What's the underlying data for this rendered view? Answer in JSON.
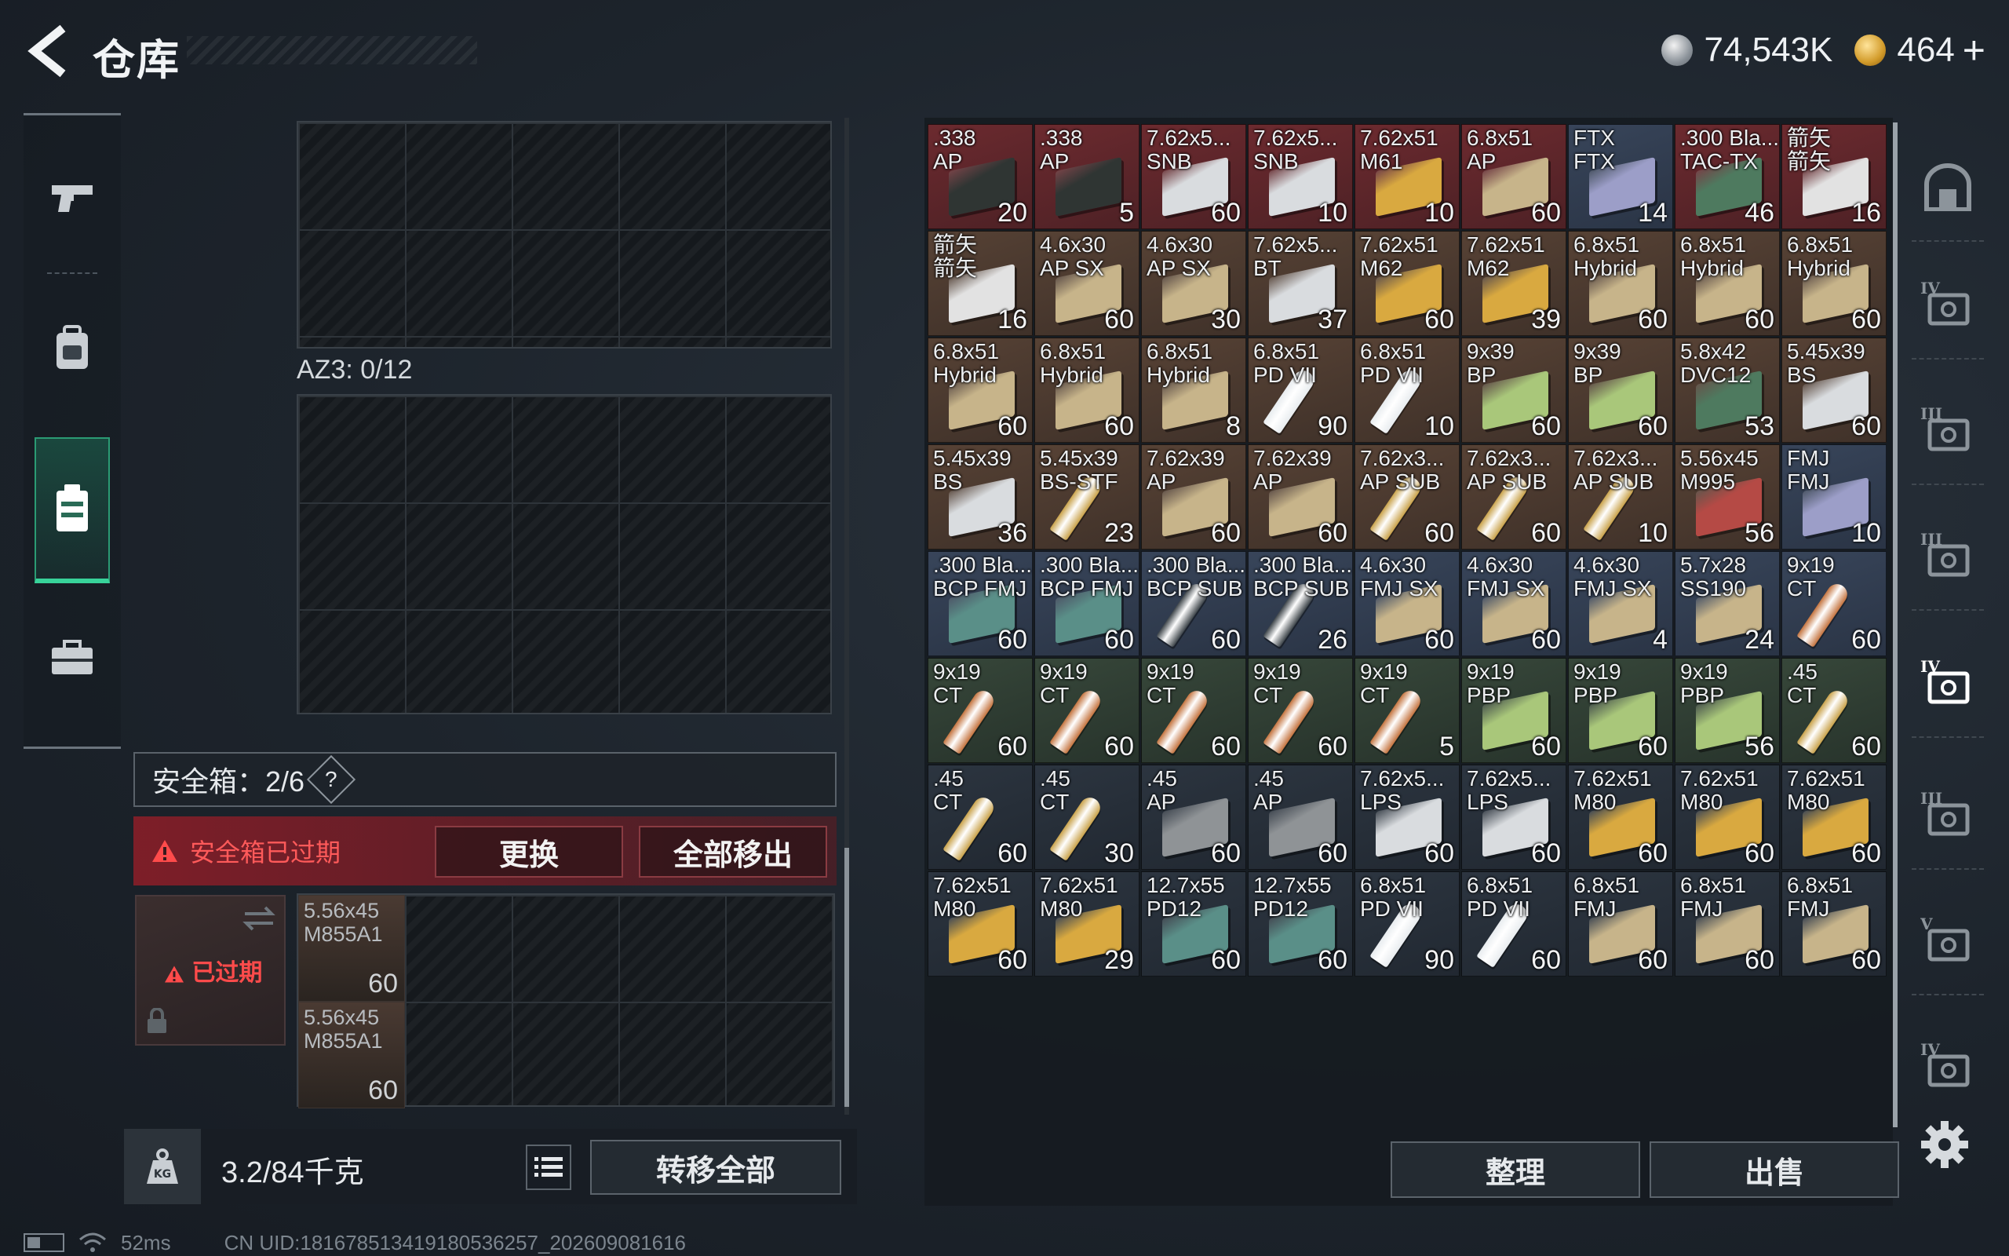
{
  "header": {
    "title": "仓库",
    "silver": "74,543K",
    "gold": "464",
    "plus": "+"
  },
  "stash": {
    "az3_label": "AZ3: 0/12",
    "safe_box_label": "安全箱：2/6",
    "help": "?",
    "expired_warning": "安全箱已过期",
    "replace_button": "更换",
    "remove_all_button": "全部移出",
    "expired_badge": "已过期",
    "safe_items": [
      {
        "name": "5.56x45\nM855A1",
        "count": "60"
      },
      {
        "name": "5.56x45\nM855A1",
        "count": "60"
      }
    ]
  },
  "bottom_left": {
    "weight": "3.2/84千克",
    "transfer_all": "转移全部"
  },
  "bottom_right": {
    "sort": "整理",
    "sell": "出售"
  },
  "status": {
    "ping": "52ms",
    "uid": "CN UID:1816785134191805362​57_202609081616"
  },
  "items": [
    {
      "name": ".338\nAP",
      "count": "20",
      "bg": "red",
      "icon": "ammo-crate-dark"
    },
    {
      "name": ".338\nAP",
      "count": "5",
      "bg": "red",
      "icon": "ammo-crate-dark"
    },
    {
      "name": "7.62x5...\nSNB",
      "count": "60",
      "bg": "red",
      "icon": "ammo-box-white"
    },
    {
      "name": "7.62x5...\nSNB",
      "count": "10",
      "bg": "red",
      "icon": "ammo-box-white"
    },
    {
      "name": "7.62x51\nM61",
      "count": "10",
      "bg": "red",
      "icon": "ammo-box-yellow"
    },
    {
      "name": "6.8x51\nAP",
      "count": "60",
      "bg": "red",
      "icon": "ammo-box-tan"
    },
    {
      "name": "FTX\nFTX",
      "count": "14",
      "bg": "blue",
      "icon": "ammo-box-violet"
    },
    {
      "name": ".300 Bla...\nTAC-TX",
      "count": "46",
      "bg": "red",
      "icon": "ammo-box-green"
    },
    {
      "name": "箭矢\n箭矢",
      "count": "16",
      "bg": "red",
      "icon": "arrow-case"
    },
    {
      "name": "箭矢\n箭矢",
      "count": "16",
      "bg": "brown",
      "icon": "arrow-case"
    },
    {
      "name": "4.6x30\nAP SX",
      "count": "60",
      "bg": "brown",
      "icon": "ammo-box-tan"
    },
    {
      "name": "4.6x30\nAP SX",
      "count": "30",
      "bg": "brown",
      "icon": "ammo-box-tan"
    },
    {
      "name": "7.62x5...\nBT",
      "count": "37",
      "bg": "brown",
      "icon": "ammo-box-white"
    },
    {
      "name": "7.62x51\nM62",
      "count": "60",
      "bg": "brown",
      "icon": "ammo-box-yellow"
    },
    {
      "name": "7.62x51\nM62",
      "count": "39",
      "bg": "brown",
      "icon": "ammo-box-yellow"
    },
    {
      "name": "6.8x51\nHybrid",
      "count": "60",
      "bg": "brown",
      "icon": "ammo-box-tan"
    },
    {
      "name": "6.8x51\nHybrid",
      "count": "60",
      "bg": "brown",
      "icon": "ammo-box-tan"
    },
    {
      "name": "6.8x51\nHybrid",
      "count": "60",
      "bg": "brown",
      "icon": "ammo-box-tan"
    },
    {
      "name": "6.8x51\nHybrid",
      "count": "60",
      "bg": "brown",
      "icon": "ammo-box-tan"
    },
    {
      "name": "6.8x51\nHybrid",
      "count": "60",
      "bg": "brown",
      "icon": "ammo-box-tan"
    },
    {
      "name": "6.8x51\nHybrid",
      "count": "8",
      "bg": "brown",
      "icon": "ammo-box-tan"
    },
    {
      "name": "6.8x51\nPD VII",
      "count": "90",
      "bg": "brown",
      "icon": "bullet-silver"
    },
    {
      "name": "6.8x51\nPD VII",
      "count": "10",
      "bg": "brown",
      "icon": "bullet-silver"
    },
    {
      "name": "9x39\nBP",
      "count": "60",
      "bg": "brown",
      "icon": "ammo-box-lime"
    },
    {
      "name": "9x39\nBP",
      "count": "60",
      "bg": "brown",
      "icon": "ammo-box-lime"
    },
    {
      "name": "5.8x42\nDVC12",
      "count": "53",
      "bg": "brown",
      "icon": "ammo-box-green"
    },
    {
      "name": "5.45x39\nBS",
      "count": "60",
      "bg": "brown",
      "icon": "ammo-box-white"
    },
    {
      "name": "5.45x39\nBS",
      "count": "36",
      "bg": "brown",
      "icon": "ammo-box-white"
    },
    {
      "name": "5.45x39\nBS-STF",
      "count": "23",
      "bg": "brown",
      "icon": "bullet-gold"
    },
    {
      "name": "7.62x39\nAP",
      "count": "60",
      "bg": "brown",
      "icon": "ammo-box-tan"
    },
    {
      "name": "7.62x39\nAP",
      "count": "60",
      "bg": "brown",
      "icon": "ammo-box-tan"
    },
    {
      "name": "7.62x3...\nAP SUB",
      "count": "60",
      "bg": "brown",
      "icon": "bullet-gold"
    },
    {
      "name": "7.62x3...\nAP SUB",
      "count": "60",
      "bg": "brown",
      "icon": "bullet-gold"
    },
    {
      "name": "7.62x3...\nAP SUB",
      "count": "10",
      "bg": "brown",
      "icon": "bullet-gold"
    },
    {
      "name": "5.56x45\nM995",
      "count": "56",
      "bg": "brown",
      "icon": "ammo-box-red"
    },
    {
      "name": "FMJ\nFMJ",
      "count": "10",
      "bg": "blue",
      "icon": "ammo-box-violet"
    },
    {
      "name": ".300 Bla...\nBCP FMJ",
      "count": "60",
      "bg": "blue",
      "icon": "ammo-box-teal"
    },
    {
      "name": ".300 Bla...\nBCP FMJ",
      "count": "60",
      "bg": "blue",
      "icon": "ammo-box-teal"
    },
    {
      "name": ".300 Bla...\nBCP SUB",
      "count": "60",
      "bg": "blue",
      "icon": "bullet-dark"
    },
    {
      "name": ".300 Bla...\nBCP SUB",
      "count": "26",
      "bg": "blue",
      "icon": "bullet-dark"
    },
    {
      "name": "4.6x30\nFMJ SX",
      "count": "60",
      "bg": "blue",
      "icon": "ammo-box-tan"
    },
    {
      "name": "4.6x30\nFMJ SX",
      "count": "60",
      "bg": "blue",
      "icon": "ammo-box-tan"
    },
    {
      "name": "4.6x30\nFMJ SX",
      "count": "4",
      "bg": "blue",
      "icon": "ammo-box-tan"
    },
    {
      "name": "5.7x28\nSS190",
      "count": "24",
      "bg": "blue",
      "icon": "ammo-box-tan"
    },
    {
      "name": "9x19\nCT",
      "count": "60",
      "bg": "blue",
      "icon": "bullet-copper"
    },
    {
      "name": "9x19\nCT",
      "count": "60",
      "bg": "green",
      "icon": "bullet-copper"
    },
    {
      "name": "9x19\nCT",
      "count": "60",
      "bg": "green",
      "icon": "bullet-copper"
    },
    {
      "name": "9x19\nCT",
      "count": "60",
      "bg": "green",
      "icon": "bullet-copper"
    },
    {
      "name": "9x19\nCT",
      "count": "60",
      "bg": "green",
      "icon": "bullet-copper"
    },
    {
      "name": "9x19\nCT",
      "count": "5",
      "bg": "green",
      "icon": "bullet-copper"
    },
    {
      "name": "9x19\nPBP",
      "count": "60",
      "bg": "green",
      "icon": "ammo-box-lime"
    },
    {
      "name": "9x19\nPBP",
      "count": "60",
      "bg": "green",
      "icon": "ammo-box-lime"
    },
    {
      "name": "9x19\nPBP",
      "count": "56",
      "bg": "green",
      "icon": "ammo-box-lime"
    },
    {
      "name": ".45\nCT",
      "count": "60",
      "bg": "green",
      "icon": "bullet-gold"
    },
    {
      "name": ".45\nCT",
      "count": "60",
      "bg": "dark",
      "icon": "bullet-gold"
    },
    {
      "name": ".45\nCT",
      "count": "30",
      "bg": "dark",
      "icon": "bullet-gold"
    },
    {
      "name": ".45\nAP",
      "count": "60",
      "bg": "dark",
      "icon": "ammo-box-grey"
    },
    {
      "name": ".45\nAP",
      "count": "60",
      "bg": "dark",
      "icon": "ammo-box-grey"
    },
    {
      "name": "7.62x5...\nLPS",
      "count": "60",
      "bg": "dark",
      "icon": "ammo-box-white"
    },
    {
      "name": "7.62x5...\nLPS",
      "count": "60",
      "bg": "dark",
      "icon": "ammo-box-white"
    },
    {
      "name": "7.62x51\nM80",
      "count": "60",
      "bg": "dark",
      "icon": "ammo-box-yellow"
    },
    {
      "name": "7.62x51\nM80",
      "count": "60",
      "bg": "dark",
      "icon": "ammo-box-yellow"
    },
    {
      "name": "7.62x51\nM80",
      "count": "60",
      "bg": "dark",
      "icon": "ammo-box-yellow"
    },
    {
      "name": "7.62x51\nM80",
      "count": "60",
      "bg": "dark",
      "icon": "ammo-box-yellow"
    },
    {
      "name": "7.62x51\nM80",
      "count": "29",
      "bg": "dark",
      "icon": "ammo-box-yellow"
    },
    {
      "name": "12.7x55\nPD12",
      "count": "60",
      "bg": "dark",
      "icon": "ammo-box-teal"
    },
    {
      "name": "12.7x55\nPD12",
      "count": "60",
      "bg": "dark",
      "icon": "ammo-box-teal"
    },
    {
      "name": "6.8x51\nPD VII",
      "count": "90",
      "bg": "dark",
      "icon": "bullet-silver"
    },
    {
      "name": "6.8x51\nPD VII",
      "count": "60",
      "bg": "dark",
      "icon": "bullet-silver"
    },
    {
      "name": "6.8x51\nFMJ",
      "count": "60",
      "bg": "dark",
      "icon": "ammo-box-tan"
    },
    {
      "name": "6.8x51\nFMJ",
      "count": "60",
      "bg": "dark",
      "icon": "ammo-box-tan"
    },
    {
      "name": "6.8x51\nFMJ",
      "count": "60",
      "bg": "dark",
      "icon": "ammo-box-tan"
    }
  ],
  "icon_colors": {
    "ammo-crate-dark": "#2f3533",
    "ammo-box-white": "#d9dcdf",
    "ammo-box-yellow": "#d9a940",
    "ammo-box-tan": "#c7b48a",
    "ammo-box-violet": "#9c9ec8",
    "ammo-box-green": "#4e7a5f",
    "ammo-box-lime": "#a9c77a",
    "ammo-box-teal": "#5a8f88",
    "ammo-box-red": "#b54a45",
    "ammo-box-grey": "#8f9396",
    "arrow-case": "#e2e2e2",
    "bullet-silver": "#e8ecef",
    "bullet-gold": "#c9a24a",
    "bullet-copper": "#c4733e",
    "bullet-dark": "#3d4449"
  },
  "right_nav": [
    "locker-icon",
    "ammo-rack-iv-icon",
    "armor-rack-iii-icon",
    "armor-rack-iii-icon",
    "ammo-folder-iv-icon",
    "rifle-rack-iii-icon",
    "ammo-rack-v-icon",
    "ammo-rack-iv-icon"
  ]
}
